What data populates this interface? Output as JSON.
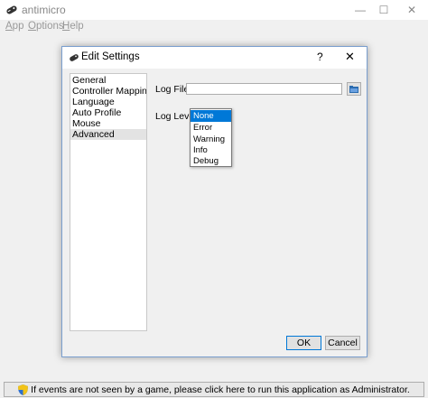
{
  "window": {
    "title": "antimicro"
  },
  "menu": [
    {
      "first": "A",
      "rest": "pp"
    },
    {
      "first": "O",
      "rest": "ptions"
    },
    {
      "first": "H",
      "rest": "elp"
    }
  ],
  "dialog": {
    "title": "Edit Settings",
    "help": "?",
    "close": "✕",
    "sidebar": [
      "General",
      "Controller Mappings",
      "Language",
      "Auto Profile",
      "Mouse",
      "Advanced"
    ],
    "selected_sidebar": "Advanced",
    "log_file_label": "Log File:",
    "log_file_value": "",
    "log_level_label": "Log Level:",
    "log_level_options": [
      "None",
      "Error",
      "Warning",
      "Info",
      "Debug"
    ],
    "log_level_selected": "None",
    "ok_label": "OK",
    "cancel_label": "Cancel"
  },
  "status": {
    "text": "If events are not seen by a game, please click here to run this application as Administrator."
  },
  "colors": {
    "accent": "#0078d7"
  }
}
